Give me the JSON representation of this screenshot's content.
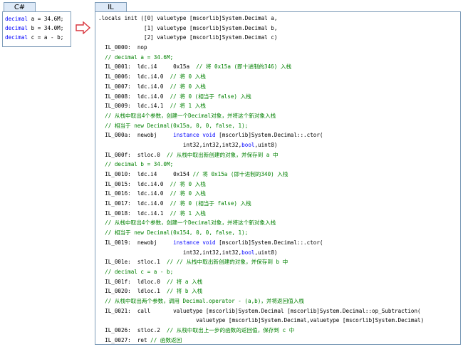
{
  "csharp": {
    "tab_label": "C#",
    "lines": [
      [
        {
          "t": "decimal",
          "k": 1
        },
        {
          "t": " a = 34.6M;"
        }
      ],
      [
        {
          "t": "decimal",
          "k": 1
        },
        {
          "t": " b = 34.0M;"
        }
      ],
      [
        {
          "t": "decimal",
          "k": 1
        },
        {
          "t": " c = a - b;"
        }
      ]
    ]
  },
  "il": {
    "tab_label": "IL",
    "lines": [
      [
        {
          "t": ".locals init ([0] valuetype [mscorlib]System.Decimal a,"
        }
      ],
      [
        {
          "t": "              [1] valuetype [mscorlib]System.Decimal b,"
        }
      ],
      [
        {
          "t": "              [2] valuetype [mscorlib]System.Decimal c)"
        }
      ],
      [
        {
          "t": "  IL_0000:  nop"
        }
      ],
      [
        {
          "t": "  // decimal a = 34.6M;",
          "c": 1
        }
      ],
      [
        {
          "t": "  IL_0001:  ldc.i4     0x15a  "
        },
        {
          "t": "// 将 0x15a (即十进制的346) 入栈",
          "c": 1
        }
      ],
      [
        {
          "t": "  IL_0006:  ldc.i4.0  "
        },
        {
          "t": "// 将 0 入栈",
          "c": 1
        }
      ],
      [
        {
          "t": "  IL_0007:  ldc.i4.0  "
        },
        {
          "t": "// 将 0 入栈",
          "c": 1
        }
      ],
      [
        {
          "t": "  IL_0008:  ldc.i4.0  "
        },
        {
          "t": "// 将 0 (相当于 false) 入栈",
          "c": 1
        }
      ],
      [
        {
          "t": "  IL_0009:  ldc.i4.1  "
        },
        {
          "t": "// 将 1 入栈",
          "c": 1
        }
      ],
      [
        {
          "t": "  // 从栈中取出4个参数，创建一个Decimal对象，并将这个新对象入栈",
          "c": 1
        }
      ],
      [
        {
          "t": "  // 相当于 new Decimal(0x15a, 0, 0, false, 1);",
          "c": 1
        }
      ],
      [
        {
          "t": "  IL_000a:  newobj     "
        },
        {
          "t": "instance",
          "k": 1
        },
        {
          "t": " "
        },
        {
          "t": "void",
          "k": 1
        },
        {
          "t": " [mscorlib]System.Decimal::.ctor("
        }
      ],
      [
        {
          "t": "                          int32,int32,int32,"
        },
        {
          "t": "bool",
          "k": 1
        },
        {
          "t": ",uint8)"
        }
      ],
      [
        {
          "t": "  IL_000f:  stloc.0  "
        },
        {
          "t": "// 从栈中取出新创建的对象，并保存到 a 中",
          "c": 1
        }
      ],
      [
        {
          "t": "  // decimal b = 34.0M;",
          "c": 1
        }
      ],
      [
        {
          "t": "  IL_0010:  ldc.i4     0x154 "
        },
        {
          "t": "// 将 0x15a (即十进制的340) 入栈",
          "c": 1
        }
      ],
      [
        {
          "t": "  IL_0015:  ldc.i4.0  "
        },
        {
          "t": "// 将 0 入栈",
          "c": 1
        }
      ],
      [
        {
          "t": "  IL_0016:  ldc.i4.0  "
        },
        {
          "t": "// 将 0 入栈",
          "c": 1
        }
      ],
      [
        {
          "t": "  IL_0017:  ldc.i4.0  "
        },
        {
          "t": "// 将 0 (相当于 false) 入栈",
          "c": 1
        }
      ],
      [
        {
          "t": "  IL_0018:  ldc.i4.1  "
        },
        {
          "t": "// 将 1 入栈",
          "c": 1
        }
      ],
      [
        {
          "t": "  // 从栈中取出4个参数，创建一个Decimal对象，并将这个新对象入栈",
          "c": 1
        }
      ],
      [
        {
          "t": "  // 相当于 new Decimal(0x154, 0, 0, false, 1);",
          "c": 1
        }
      ],
      [
        {
          "t": "  IL_0019:  newobj     "
        },
        {
          "t": "instance",
          "k": 1
        },
        {
          "t": " "
        },
        {
          "t": "void",
          "k": 1
        },
        {
          "t": " [mscorlib]System.Decimal::.ctor("
        }
      ],
      [
        {
          "t": "                          int32,int32,int32,"
        },
        {
          "t": "bool",
          "k": 1
        },
        {
          "t": ",uint8)"
        }
      ],
      [
        {
          "t": "  IL_001e:  stloc.1  "
        },
        {
          "t": "// // 从栈中取出新创建的对象，并保存到 b 中",
          "c": 1
        }
      ],
      [
        {
          "t": "  // decimal c = a - b;",
          "c": 1
        }
      ],
      [
        {
          "t": "  IL_001f:  ldloc.0  "
        },
        {
          "t": "// 将 a 入栈",
          "c": 1
        }
      ],
      [
        {
          "t": "  IL_0020:  ldloc.1  "
        },
        {
          "t": "// 将 b 入栈",
          "c": 1
        }
      ],
      [
        {
          "t": "  // 从栈中取出两个参数，调用 Decimal.operator - (a,b)，并将返回值入栈",
          "c": 1
        }
      ],
      [
        {
          "t": "  IL_0021:  call       valuetype [mscorlib]System.Decimal [mscorlib]System.Decimal::op_Subtraction("
        }
      ],
      [
        {
          "t": "                              valuetype [mscorlib]System.Decimal,valuetype [mscorlib]System.Decimal)"
        }
      ],
      [
        {
          "t": "  IL_0026:  stloc.2  "
        },
        {
          "t": "// 从栈中取出上一步的函数的返回值，保存到 c 中",
          "c": 1
        }
      ],
      [
        {
          "t": "  IL_0027:  ret "
        },
        {
          "t": "// 函数返回",
          "c": 1
        }
      ]
    ]
  }
}
